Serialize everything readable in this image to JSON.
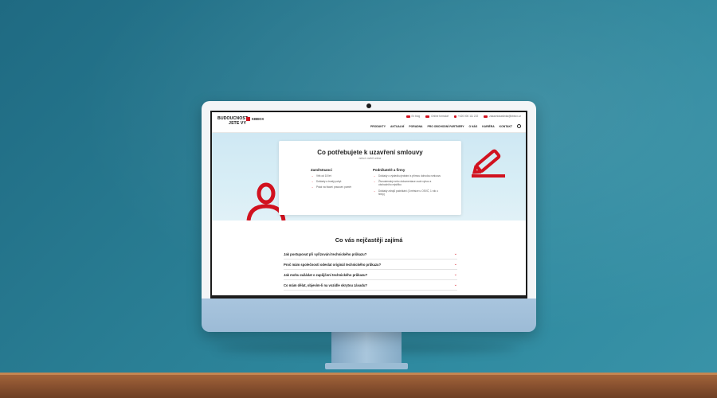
{
  "site": {
    "logo_lines": [
      "BUDOUCNOST",
      "JSTE VY"
    ],
    "brand": "KBBOX",
    "topbar": [
      {
        "icon": "like-icon",
        "label": "Ex blog"
      },
      {
        "icon": "chat-icon",
        "label": "Online formulář"
      },
      {
        "icon": "phone-icon",
        "label": "+420 000 111 222"
      },
      {
        "icon": "mail-icon",
        "label": "zakaznickaslinka@kbbox.cz"
      }
    ],
    "nav": [
      "PRODUKTY",
      "AKTUALNÍ",
      "PORADNA",
      "PRO OBCHODNÍ PARTNERY",
      "O NÁS",
      "KARIÉRA",
      "KONTAKT"
    ]
  },
  "hero": {
    "title": "Co potřebujete k uzavření smlouvy",
    "subtitle": "nebo k úvěrů online",
    "employees": {
      "heading": "Zaměstnanci",
      "items": [
        "Věk od 18 let",
        "Doklady a trvalý pobyt",
        "Práci na hlavní pracovní poměr"
      ]
    },
    "business": {
      "heading": "Podnikatelé a firmy",
      "items": [
        "Doklady o výsledku jednání s přímou dohodou smlouvu",
        "Živnostenský nebo dokumentace osob vyhoz a obchodního rejstříku",
        "Doklady zdrojů podnikání (3 měsíce u OSVČ, 1 rok u firmy)"
      ]
    }
  },
  "faq": {
    "title": "Co vás nejčastěji zajímá",
    "questions": [
      "Jak postupovat při vyřizování technického průkazu?",
      "Proč mám společnosti odeslat originál technického průkazu?",
      "Jak mohu zažádat o zapůjčení technického průkazu?",
      "Co mám dělat, objevím-li na vozidle skrytou závadu?"
    ]
  },
  "colors": {
    "accent": "#d1121f",
    "wall": "#2a7f95",
    "imac_chin": "#a9c5de"
  }
}
